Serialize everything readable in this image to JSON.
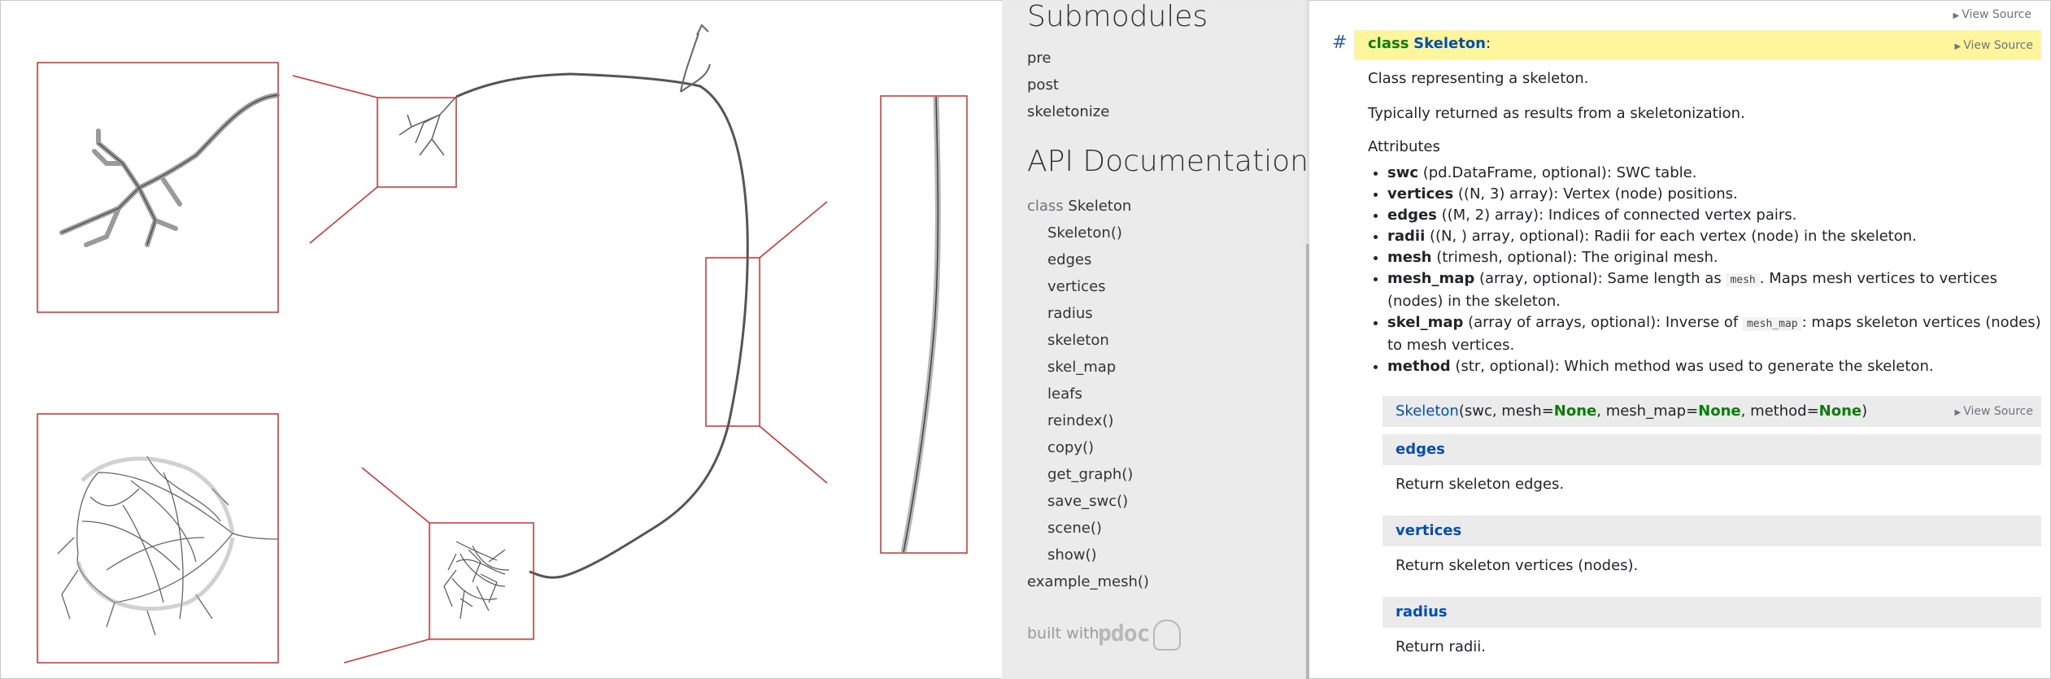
{
  "sidebar": {
    "submodules_heading": "Submodules",
    "submodules": [
      "pre",
      "post",
      "skeletonize"
    ],
    "api_heading": "API Documentation",
    "class_keyword": "class",
    "class_name": "Skeleton",
    "members": [
      "Skeleton()",
      "edges",
      "vertices",
      "radius",
      "skeleton",
      "skel_map",
      "leafs",
      "reindex()",
      "copy()",
      "get_graph()",
      "save_swc()",
      "scene()",
      "show()"
    ],
    "example": "example_mesh()",
    "built_with": "built with",
    "pdoc_logo": "pdoc"
  },
  "main": {
    "view_source": "View Source",
    "anchor": "#",
    "class_keyword": "class",
    "class_name": "Skeleton",
    "class_colon": ":",
    "summary": "Class representing a skeleton.",
    "typically": "Typically returned as results from a skeletonization.",
    "attributes_heading": "Attributes",
    "attributes": [
      {
        "name": "swc",
        "desc": " (pd.DataFrame, optional): SWC table."
      },
      {
        "name": "vertices",
        "desc": " ((N, 3) array): Vertex (node) positions."
      },
      {
        "name": "edges",
        "desc": " ((M, 2) array): Indices of connected vertex pairs."
      },
      {
        "name": "radii",
        "desc": " ((N, ) array, optional): Radii for each vertex (node) in the skeleton."
      },
      {
        "name": "mesh",
        "desc": " (trimesh, optional): The original mesh."
      },
      {
        "name": "mesh_map",
        "desc_pre": " (array, optional): Same length as ",
        "code": "mesh",
        "desc_post": ". Maps mesh vertices to vertices (nodes) in the skeleton."
      },
      {
        "name": "skel_map",
        "desc_pre": " (array of arrays, optional): Inverse of ",
        "code": "mesh_map",
        "desc_post": ": maps skeleton vertices (nodes) to mesh vertices."
      },
      {
        "name": "method",
        "desc": " (str, optional): Which method was used to generate the skeleton."
      }
    ],
    "signature": {
      "name": "Skeleton",
      "p1": "(swc, mesh=",
      "none1": "None",
      "p2": ", mesh_map=",
      "none2": "None",
      "p3": ", method=",
      "none3": "None",
      "p4": ")"
    },
    "members": [
      {
        "name": "edges",
        "desc": "Return skeleton edges."
      },
      {
        "name": "vertices",
        "desc": "Return skeleton vertices (nodes)."
      },
      {
        "name": "radius",
        "desc": "Return radii."
      }
    ]
  },
  "colors": {
    "highlight": "#fff59d",
    "zoom_box": "#d32f2f",
    "keyword_green": "#0b7d0b",
    "name_blue": "#0550ae"
  }
}
